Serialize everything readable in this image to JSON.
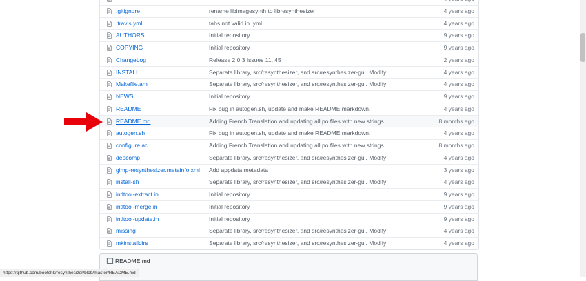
{
  "files": [
    {
      "name": "",
      "message": "",
      "age": "4 years ago",
      "icon": "file-icon"
    },
    {
      "name": ".gitignore",
      "message": "rename libimagesynth to libresynthesizer",
      "age": "4 years ago",
      "icon": "file-icon"
    },
    {
      "name": ".travis.yml",
      "message": "tabs not valid in .yml",
      "age": "4 years ago",
      "icon": "file-icon"
    },
    {
      "name": "AUTHORS",
      "message": "Initial repository",
      "age": "9 years ago",
      "icon": "file-icon"
    },
    {
      "name": "COPYING",
      "message": "Initial repository",
      "age": "9 years ago",
      "icon": "file-icon"
    },
    {
      "name": "ChangeLog",
      "message": "Release 2.0.3 Issues 11, 45",
      "age": "2 years ago",
      "icon": "file-icon"
    },
    {
      "name": "INSTALL",
      "message": "Separate library, src/resynthesizer, and src/resynthesizer-gui. Modify",
      "age": "4 years ago",
      "icon": "file-icon"
    },
    {
      "name": "Makefile.am",
      "message": "Separate library, src/resynthesizer, and src/resynthesizer-gui. Modify",
      "age": "4 years ago",
      "icon": "file-icon"
    },
    {
      "name": "NEWS",
      "message": "Initial repository",
      "age": "9 years ago",
      "icon": "file-icon"
    },
    {
      "name": "README",
      "message": "Fix bug in autogen.sh, update and make README markdown.",
      "age": "4 years ago",
      "icon": "file-icon"
    },
    {
      "name": "README.md",
      "message": "Adding French Translation and updating all po files with new strings....",
      "age": "8 months ago",
      "icon": "file-icon"
    },
    {
      "name": "autogen.sh",
      "message": "Fix bug in autogen.sh, update and make README markdown.",
      "age": "4 years ago",
      "icon": "file-icon"
    },
    {
      "name": "configure.ac",
      "message": "Adding French Translation and updating all po files with new strings....",
      "age": "8 months ago",
      "icon": "file-icon"
    },
    {
      "name": "depcomp",
      "message": "Separate library, src/resynthesizer, and src/resynthesizer-gui. Modify",
      "age": "4 years ago",
      "icon": "file-icon"
    },
    {
      "name": "gimp-resynthesizer.metainfo.xml",
      "message": "Add appdata metadata",
      "age": "3 years ago",
      "icon": "file-icon"
    },
    {
      "name": "install-sh",
      "message": "Separate library, src/resynthesizer, and src/resynthesizer-gui. Modify",
      "age": "4 years ago",
      "icon": "file-icon"
    },
    {
      "name": "intltool-extract.in",
      "message": "Initial repository",
      "age": "9 years ago",
      "icon": "file-icon"
    },
    {
      "name": "intltool-merge.in",
      "message": "Initial repository",
      "age": "9 years ago",
      "icon": "file-icon"
    },
    {
      "name": "intltool-update.in",
      "message": "Initial repository",
      "age": "9 years ago",
      "icon": "file-icon"
    },
    {
      "name": "missing",
      "message": "Separate library, src/resynthesizer, and src/resynthesizer-gui. Modify",
      "age": "4 years ago",
      "icon": "file-icon"
    },
    {
      "name": "mkinstalldirs",
      "message": "Separate library, src/resynthesizer, and src/resynthesizer-gui. Modify",
      "age": "4 years ago",
      "icon": "file-icon"
    }
  ],
  "highlighted_file": "README.md",
  "readme_header": {
    "title": "README.md",
    "icon": "book-icon"
  },
  "status_bar": {
    "url": "https://github.com/bootchk/resynthesizer/blob/master/README.md"
  },
  "annotation": {
    "icon": "red-arrow-icon",
    "color": "#e8000b"
  },
  "colors": {
    "link": "#0366d6",
    "muted": "#586069",
    "border": "#e1e4e8"
  }
}
